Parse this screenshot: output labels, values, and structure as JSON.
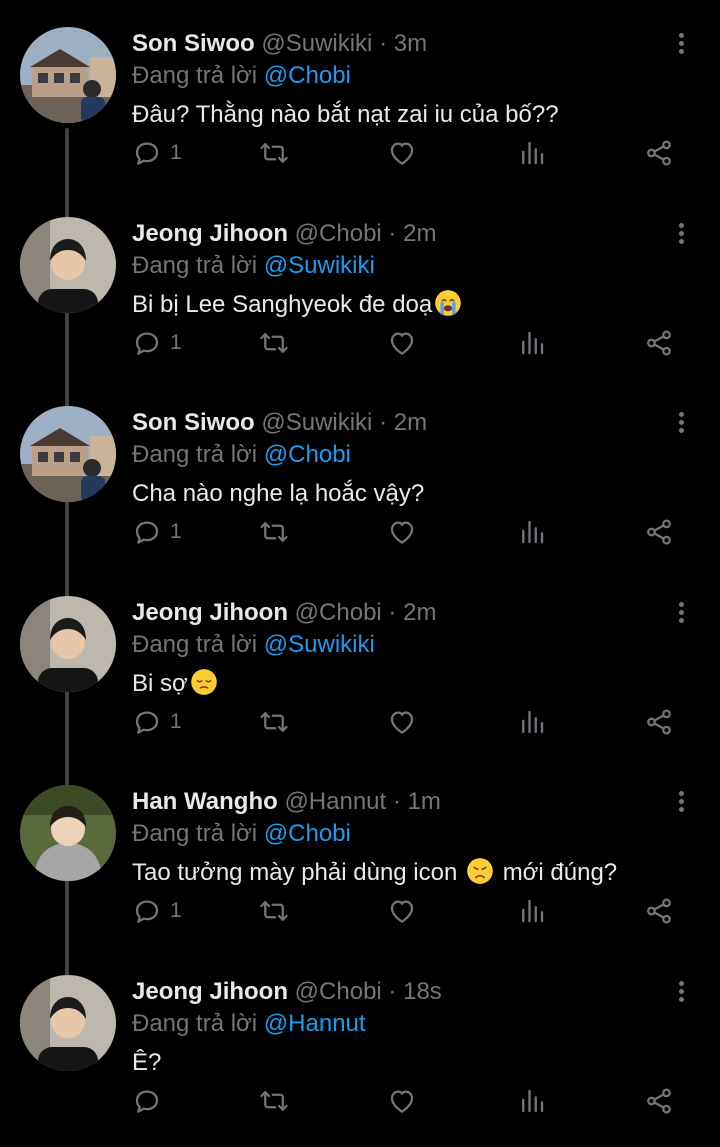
{
  "tweets": [
    {
      "name": "Son Siwoo",
      "handle": "@Suwikiki",
      "separator": "·",
      "time": "3m",
      "reply_prefix": "Đang trả lời",
      "reply_to": "@Chobi",
      "text": "Đâu? Thằng nào bắt nạt zai iu của bố??",
      "emoji": "",
      "text_after": "",
      "reply_count": "1",
      "avatar": "avatar-building"
    },
    {
      "name": "Jeong Jihoon",
      "handle": "@Chobi",
      "separator": "·",
      "time": "2m",
      "reply_prefix": "Đang trả lời",
      "reply_to": "@Suwikiki",
      "text": "Bi bị Lee Sanghyeok đe doạ",
      "emoji": "crying-face",
      "text_after": "",
      "reply_count": "1",
      "avatar": "avatar-boy"
    },
    {
      "name": "Son Siwoo",
      "handle": "@Suwikiki",
      "separator": "·",
      "time": "2m",
      "reply_prefix": "Đang trả lời",
      "reply_to": "@Chobi",
      "text": "Cha nào nghe lạ hoắc vậy?",
      "emoji": "",
      "text_after": "",
      "reply_count": "1",
      "avatar": "avatar-building"
    },
    {
      "name": "Jeong Jihoon",
      "handle": "@Chobi",
      "separator": "·",
      "time": "2m",
      "reply_prefix": "Đang trả lời",
      "reply_to": "@Suwikiki",
      "text": "Bi sợ",
      "emoji": "pensive-face",
      "text_after": "",
      "reply_count": "1",
      "avatar": "avatar-boy"
    },
    {
      "name": "Han Wangho",
      "handle": "@Hannut",
      "separator": "·",
      "time": "1m",
      "reply_prefix": "Đang trả lời",
      "reply_to": "@Chobi",
      "text": "Tao tưởng mày phải dùng icon",
      "emoji": "disappointed-face",
      "text_after": "mới đúng?",
      "reply_count": "1",
      "avatar": "avatar-hoodie"
    },
    {
      "name": "Jeong Jihoon",
      "handle": "@Chobi",
      "separator": "·",
      "time": "18s",
      "reply_prefix": "Đang trả lời",
      "reply_to": "@Hannut",
      "text": "Ê?",
      "emoji": "",
      "text_after": "",
      "reply_count": "",
      "avatar": "avatar-boy"
    }
  ],
  "colors": {
    "background": "#000000",
    "text": "#e7e9ea",
    "muted": "#71767b",
    "mention": "#1d9bf0",
    "thread_line": "#3d4246"
  }
}
